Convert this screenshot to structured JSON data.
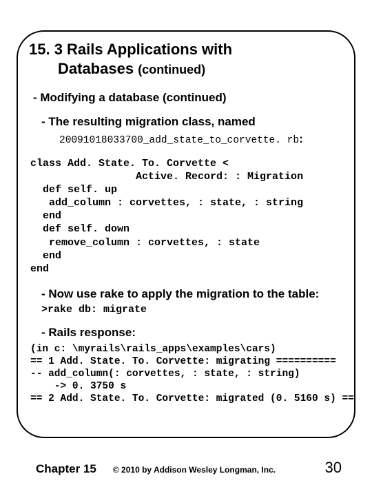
{
  "title": {
    "line1": "15. 3 Rails Applications with",
    "line2_prefix": "Databases ",
    "line2_cont": "(continued)"
  },
  "b1": "- Modifying a database (continued)",
  "b2": "- The resulting migration class, named",
  "filename": "20091018033700_add_state_to_corvette. rb",
  "code": "class Add. State. To. Corvette <\n                 Active. Record: : Migration\n  def self. up\n   add_column : corvettes, : state, : string\n  end\n  def self. down\n   remove_column : corvettes, : state\n  end\nend",
  "b3": "- Now use rake to apply the migration to the table:",
  "cmd": ">rake db: migrate",
  "b4": "- Rails response:",
  "output": "(in c: \\myrails\\rails_apps\\examples\\cars)\n== 1 Add. State. To. Corvette: migrating ==========\n-- add_column(: corvettes, : state, : string)\n    -> 0. 3750 s\n== 2 Add. State. To. Corvette: migrated (0. 5160 s) ==",
  "footer": {
    "chapter": "Chapter 15",
    "copyright": "© 2010 by Addison Wesley Longman, Inc.",
    "page": "30"
  }
}
